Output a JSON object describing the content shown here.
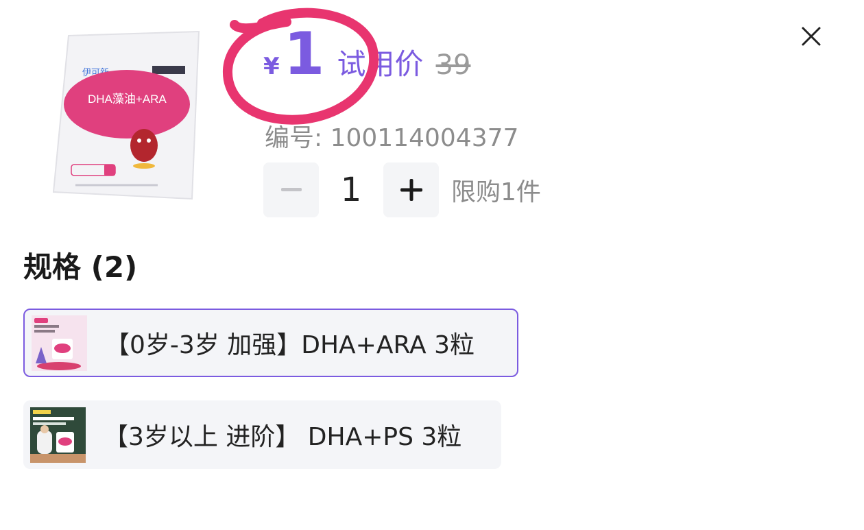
{
  "price": {
    "currency": "¥",
    "value": "1",
    "label": "试用价",
    "original": "39"
  },
  "product": {
    "code_text": "编号: 100114004377",
    "image_brand": "伊可新",
    "image_text": "DHA藻油+ARA"
  },
  "quantity": {
    "value": "1",
    "limit_text": "限购1件"
  },
  "spec": {
    "title": "规格 (2)",
    "options": [
      {
        "label": "【0岁-3岁 加强】DHA+ARA 3粒",
        "selected": true
      },
      {
        "label": "【3岁以上 进阶】 DHA+PS 3粒",
        "selected": false
      }
    ]
  },
  "colors": {
    "accent": "#7b5be0",
    "circle": "#e8356f"
  }
}
